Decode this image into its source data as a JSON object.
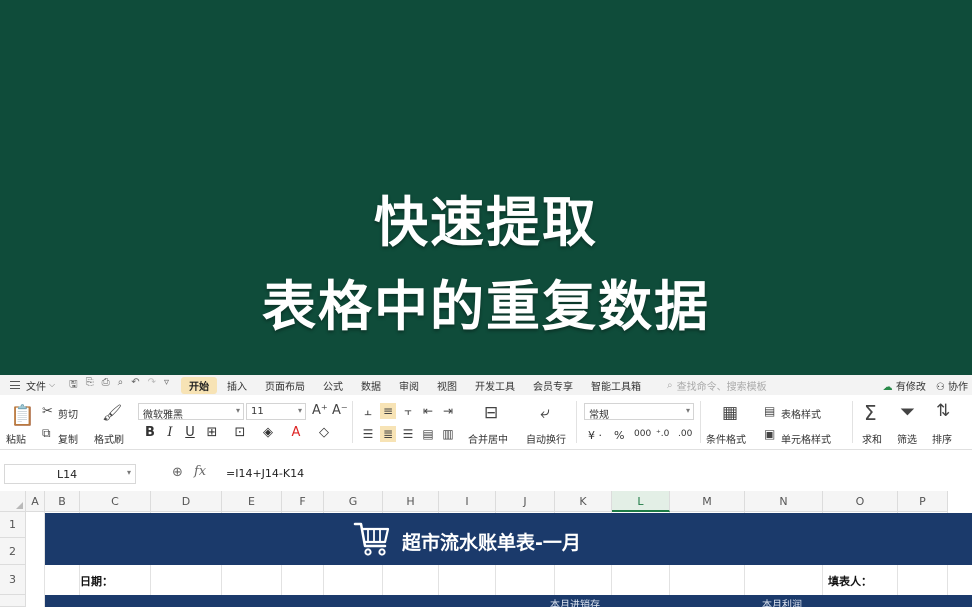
{
  "banner": {
    "line1": "快速提取",
    "line2": "表格中的重复数据"
  },
  "menubar": {
    "file": "文件",
    "tabs": [
      "开始",
      "插入",
      "页面布局",
      "公式",
      "数据",
      "审阅",
      "视图",
      "开发工具",
      "会员专享",
      "智能工具箱"
    ],
    "active_tab": "开始",
    "search_placeholder": "查找命令、搜索模板",
    "modified": "有修改",
    "collab": "协作"
  },
  "ribbon": {
    "paste": "粘贴",
    "cut": "剪切",
    "copy": "复制",
    "format_painter": "格式刷",
    "font_name": "微软雅黑",
    "font_size": "11",
    "merge_center": "合并居中",
    "wrap_text": "自动换行",
    "number_format": "常规",
    "conditional_format": "条件格式",
    "table_style": "表格样式",
    "cell_style": "单元格样式",
    "sum": "求和",
    "filter": "筛选",
    "sort": "排序"
  },
  "formulabar": {
    "cell_ref": "L14",
    "formula": "=I14+J14-K14"
  },
  "grid": {
    "columns": [
      "A",
      "B",
      "C",
      "D",
      "E",
      "F",
      "G",
      "H",
      "I",
      "J",
      "K",
      "L",
      "M",
      "N",
      "O",
      "P"
    ],
    "active_column": "L",
    "rows": [
      "1",
      "2",
      "3"
    ],
    "sheet_title": "超市流水账单表-一月",
    "date_label": "日期：",
    "filler_label": "填表人：",
    "header_partial_1": "本月进销存",
    "header_partial_2": "本月利润"
  },
  "colors": {
    "banner_bg": "#0f4c3a",
    "title_band": "#1b3a6b",
    "active_tab": "#f7e3b5",
    "active_col": "#1e7b45"
  }
}
